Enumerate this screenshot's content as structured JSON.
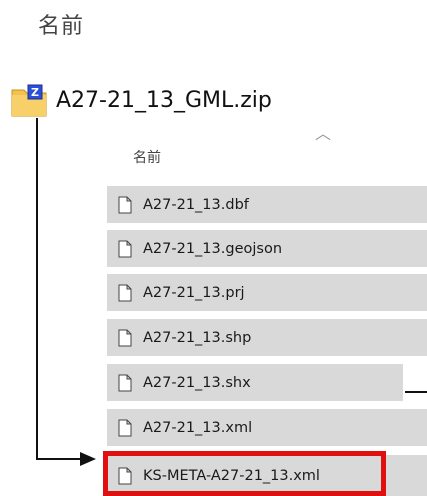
{
  "header": {
    "name_column_label": "名前"
  },
  "archive": {
    "file_name": "A27-21_13_GML.zip",
    "icon": "zip-archive-icon"
  },
  "list": {
    "column_header": "名前",
    "files": [
      {
        "name": "A27-21_13.dbf"
      },
      {
        "name": "A27-21_13.geojson"
      },
      {
        "name": "A27-21_13.prj"
      },
      {
        "name": "A27-21_13.shp"
      },
      {
        "name": "A27-21_13.shx"
      },
      {
        "name": "A27-21_13.xml"
      },
      {
        "name": "KS-META-A27-21_13.xml"
      }
    ]
  },
  "colors": {
    "row_background": "#d9d9d9",
    "highlight": "#e01010",
    "connector": "#111111"
  }
}
